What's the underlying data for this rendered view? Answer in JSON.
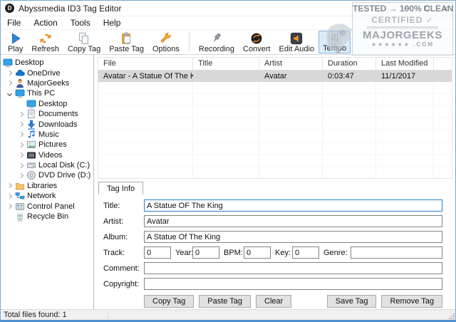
{
  "window": {
    "title": "Abyssmedia ID3 Tag Editor",
    "app_icon_letter": "D",
    "controls": [
      "minimize",
      "maximize",
      "close"
    ]
  },
  "menu": {
    "items": [
      "File",
      "Action",
      "Tools",
      "Help"
    ]
  },
  "toolbar": {
    "groups": [
      {
        "buttons": [
          {
            "label": "Play",
            "icon": "play"
          },
          {
            "label": "Refresh",
            "icon": "refresh"
          },
          {
            "label": "Copy Tag",
            "icon": "copy"
          },
          {
            "label": "Paste Tag",
            "icon": "paste"
          },
          {
            "label": "Options",
            "icon": "options"
          }
        ]
      },
      {
        "buttons": [
          {
            "label": "Recording",
            "icon": "microphone"
          },
          {
            "label": "Convert",
            "icon": "convert"
          },
          {
            "label": "Edit Audio",
            "icon": "edit-audio"
          },
          {
            "label": "Tempo",
            "icon": "tempo",
            "active": true
          }
        ]
      }
    ]
  },
  "tree": {
    "items": [
      {
        "label": "Desktop",
        "icon": "monitor",
        "level": 0,
        "expander": "none"
      },
      {
        "label": "OneDrive",
        "icon": "cloud",
        "level": 1,
        "expander": "collapsed"
      },
      {
        "label": "MajorGeeks",
        "icon": "user",
        "level": 1,
        "expander": "collapsed"
      },
      {
        "label": "This PC",
        "icon": "monitor",
        "level": 1,
        "expander": "expanded"
      },
      {
        "label": "Desktop",
        "icon": "monitor",
        "level": 2,
        "expander": "none"
      },
      {
        "label": "Documents",
        "icon": "document",
        "level": 2,
        "expander": "collapsed"
      },
      {
        "label": "Downloads",
        "icon": "download",
        "level": 2,
        "expander": "collapsed"
      },
      {
        "label": "Music",
        "icon": "music-note",
        "level": 2,
        "expander": "collapsed"
      },
      {
        "label": "Pictures",
        "icon": "picture",
        "level": 2,
        "expander": "collapsed"
      },
      {
        "label": "Videos",
        "icon": "video",
        "level": 2,
        "expander": "collapsed"
      },
      {
        "label": "Local Disk (C:)",
        "icon": "hard-disk",
        "level": 2,
        "expander": "collapsed"
      },
      {
        "label": "DVD Drive (D:)",
        "icon": "dvd-disc",
        "level": 2,
        "expander": "collapsed"
      },
      {
        "label": "Libraries",
        "icon": "folder",
        "level": 1,
        "expander": "collapsed"
      },
      {
        "label": "Network",
        "icon": "network",
        "level": 1,
        "expander": "collapsed"
      },
      {
        "label": "Control Panel",
        "icon": "control-panel",
        "level": 1,
        "expander": "collapsed"
      },
      {
        "label": "Recycle Bin",
        "icon": "recycle-bin",
        "level": 1,
        "expander": "none"
      }
    ]
  },
  "file_list": {
    "columns": [
      "File",
      "Title",
      "Artist",
      "Duration",
      "Last Modified"
    ],
    "rows": [
      {
        "selected": true,
        "cells": [
          "Avatar - A Statue Of The King....",
          "",
          "Avatar",
          "0:03:47",
          "11/1/2017"
        ]
      }
    ]
  },
  "tag_info": {
    "tab_label": "Tag Info",
    "fields": {
      "title": {
        "label": "Title:",
        "value": "A Statue OF The King"
      },
      "artist": {
        "label": "Artist:",
        "value": "Avatar"
      },
      "album": {
        "label": "Album:",
        "value": "A Statue Of The King"
      },
      "track": {
        "label": "Track:",
        "value": "0"
      },
      "year": {
        "label": "Year:",
        "value": "0"
      },
      "bpm": {
        "label": "BPM:",
        "value": "0"
      },
      "key": {
        "label": "Key:",
        "value": "0"
      },
      "genre": {
        "label": "Genre:",
        "value": ""
      },
      "comment": {
        "label": "Comment:",
        "value": ""
      },
      "copyright": {
        "label": "Copyright:",
        "value": ""
      }
    },
    "buttons_left": [
      "Copy Tag",
      "Paste Tag",
      "Clear"
    ],
    "buttons_right": [
      "Save Tag",
      "Remove Tag"
    ]
  },
  "status_bar": {
    "text": "Total files found: 1"
  },
  "watermark": {
    "line1": "TESTED → 100% CLEAN",
    "line2": "CERTIFIED",
    "check": "✓",
    "line3": "MAJORGEEKS",
    "line4": "★★★★★★ .COM"
  },
  "colors": {
    "accent_border": "#4e8fcd",
    "selection": "#d8d8d8",
    "focus_border": "#2a7ecc",
    "toolbar_orange": "#f08a24",
    "icon_blue": "#2f7ad4"
  }
}
